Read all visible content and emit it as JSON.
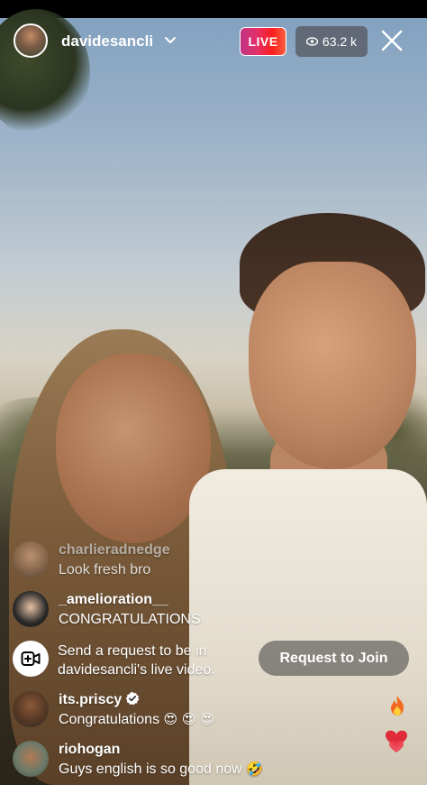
{
  "header": {
    "username": "davidesancli",
    "live_label": "LIVE",
    "viewer_count": "63.2 k"
  },
  "comments": [
    {
      "username": "charlieradnedge",
      "text": "Look fresh bro",
      "faded": true
    },
    {
      "username": "_amelioration__",
      "text": "CONGRATULATIONS"
    },
    {
      "username": "its.priscy",
      "text": "Congratulations",
      "emojis": "😍 😍 😍",
      "verified": true
    },
    {
      "username": "riohogan",
      "text": "Guys english is so good now",
      "emojis": "🤣"
    }
  ],
  "join_request": {
    "text": "Send a request to be in davidesancli's live video.",
    "button_label": "Request to Join"
  },
  "colors": {
    "live_gradient_start": "#c13584",
    "live_gradient_end": "#f56040",
    "verified_badge": "#ffffff"
  },
  "icons": [
    "chevron-down-icon",
    "eye-icon",
    "close-icon",
    "video-plus-icon",
    "verified-icon",
    "fire-icon",
    "heart-icon"
  ]
}
